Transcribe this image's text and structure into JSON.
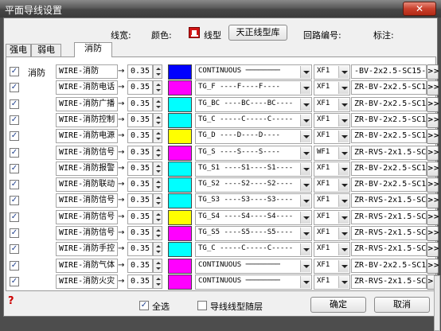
{
  "window": {
    "title": "平面导线设置",
    "close_label": "✕"
  },
  "header": {
    "width_label": "线宽:",
    "color_label": "颜色:",
    "linetype_label": "线型",
    "library_button": "天正线型库",
    "loop_label": "回路编号:",
    "note_label": "标注:"
  },
  "tabs": [
    {
      "label": "强电",
      "active": false
    },
    {
      "label": "弱电",
      "active": false
    },
    {
      "label": "消防",
      "active": true
    }
  ],
  "section_label": "消防",
  "rows": [
    {
      "checked": true,
      "name": "WIRE-消防",
      "width": "0.35",
      "color": "#0000ff",
      "linetype": "CONTINUOUS ────────",
      "loop": "XF1",
      "spec": "-BV-2x2.5-SC15-WC"
    },
    {
      "checked": true,
      "name": "WIRE-消防电话",
      "width": "0.35",
      "color": "#ff00ff",
      "linetype": "TG_F ----F----F----",
      "loop": "XF1",
      "spec": "ZR-BV-2x2.5-SC15-"
    },
    {
      "checked": true,
      "name": "WIRE-消防广播",
      "width": "0.35",
      "color": "#00ffff",
      "linetype": "TG_BC ----BC----BC----",
      "loop": "XF1",
      "spec": "ZR-BV-2x2.5-SC15-"
    },
    {
      "checked": true,
      "name": "WIRE-消防控制",
      "width": "0.35",
      "color": "#00ffff",
      "linetype": "TG_C -----C-----C-----",
      "loop": "XF1",
      "spec": "ZR-BV-2x2.5-SC15-"
    },
    {
      "checked": true,
      "name": "WIRE-消防电源",
      "width": "0.35",
      "color": "#ffff00",
      "linetype": "TG_D ----D----D----",
      "loop": "XF1",
      "spec": "ZR-BV-2x2.5-SC15-"
    },
    {
      "checked": true,
      "name": "WIRE-消防信号",
      "width": "0.35",
      "color": "#ff00ff",
      "linetype": "TG_S ----S----S----",
      "loop": "WF1",
      "spec": "ZR-RVS-2x1.5-SC2("
    },
    {
      "checked": true,
      "name": "WIRE-消防报警",
      "width": "0.35",
      "color": "#00ffff",
      "linetype": "TG_S1 ----S1----S1----",
      "loop": "XF1",
      "spec": "ZR-BV-2x2.5-SC15-"
    },
    {
      "checked": true,
      "name": "WIRE-消防联动",
      "width": "0.35",
      "color": "#00ffff",
      "linetype": "TG_S2 ----S2----S2----",
      "loop": "XF1",
      "spec": "ZR-BV-2x2.5-SC15-"
    },
    {
      "checked": true,
      "name": "WIRE-消防信号",
      "width": "0.35",
      "color": "#00ffff",
      "linetype": "TG_S3 ----S3----S3----",
      "loop": "XF1",
      "spec": "ZR-RVS-2x1.5-SC2("
    },
    {
      "checked": true,
      "name": "WIRE-消防信号",
      "width": "0.35",
      "color": "#ffff00",
      "linetype": "TG_S4 ----S4----S4----",
      "loop": "XF1",
      "spec": "ZR-RVS-2x1.5-SC2("
    },
    {
      "checked": true,
      "name": "WIRE-消防信号",
      "width": "0.35",
      "color": "#ff00ff",
      "linetype": "TG_S5 ----S5----S5----",
      "loop": "XF1",
      "spec": "ZR-RVS-2x1.5-SC2("
    },
    {
      "checked": true,
      "name": "WIRE-消防手控",
      "width": "0.35",
      "color": "#00ffff",
      "linetype": "TG_C -----C-----C-----",
      "loop": "XF1",
      "spec": "ZR-RVS-2x1.5-SC2("
    },
    {
      "checked": true,
      "name": "WIRE-消防气体",
      "width": "0.35",
      "color": "#ff00ff",
      "linetype": "CONTINUOUS ────────",
      "loop": "XF1",
      "spec": "ZR-BV-2x2.5-SC15-"
    },
    {
      "checked": true,
      "name": "WIRE-消防火灾",
      "width": "0.35",
      "color": "#ff00ff",
      "linetype": "CONTINUOUS ────────",
      "loop": "XF1",
      "spec": "ZR-RVS-2x1.5-SC2("
    }
  ],
  "footer": {
    "help_icon": "?",
    "select_all_label": "全选",
    "select_all_checked": true,
    "follow_layer_label": "导线线型随层",
    "follow_layer_checked": false,
    "ok_button": "确定",
    "cancel_button": "取消"
  }
}
